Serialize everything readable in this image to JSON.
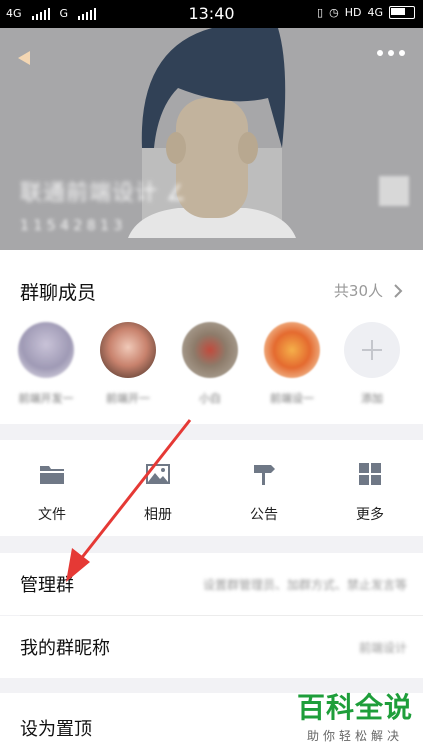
{
  "status_bar": {
    "sim1": "4G",
    "sim2": "G",
    "time": "13:40",
    "hd": "HD",
    "network": "4G"
  },
  "header": {
    "group_name": "联通前端设计 ∠",
    "group_id": "1 1 5 4 2 8 1 3"
  },
  "members": {
    "title": "群聊成员",
    "count": "共30人",
    "items": [
      {
        "name": "前端开发一"
      },
      {
        "name": "前端开一"
      },
      {
        "name": "小白"
      },
      {
        "name": "前端设一"
      }
    ],
    "add_label": "添加"
  },
  "tools": [
    {
      "label": "文件",
      "icon": "folder-icon"
    },
    {
      "label": "相册",
      "icon": "image-icon"
    },
    {
      "label": "公告",
      "icon": "signpost-icon"
    },
    {
      "label": "更多",
      "icon": "grid-icon"
    }
  ],
  "settings": {
    "manage": {
      "label": "管理群",
      "value": "设置群管理员、加群方式、禁止发言等"
    },
    "nickname": {
      "label": "我的群昵称",
      "value": "前端设计"
    },
    "pin": {
      "label": "设为置顶"
    }
  },
  "watermark": {
    "main": "百科全说",
    "sub": "助你轻松解决"
  },
  "colors": {
    "header_bg": "#a7a7a9",
    "annotation_arrow": "#e53935",
    "watermark_green": "#1e9e3a"
  }
}
